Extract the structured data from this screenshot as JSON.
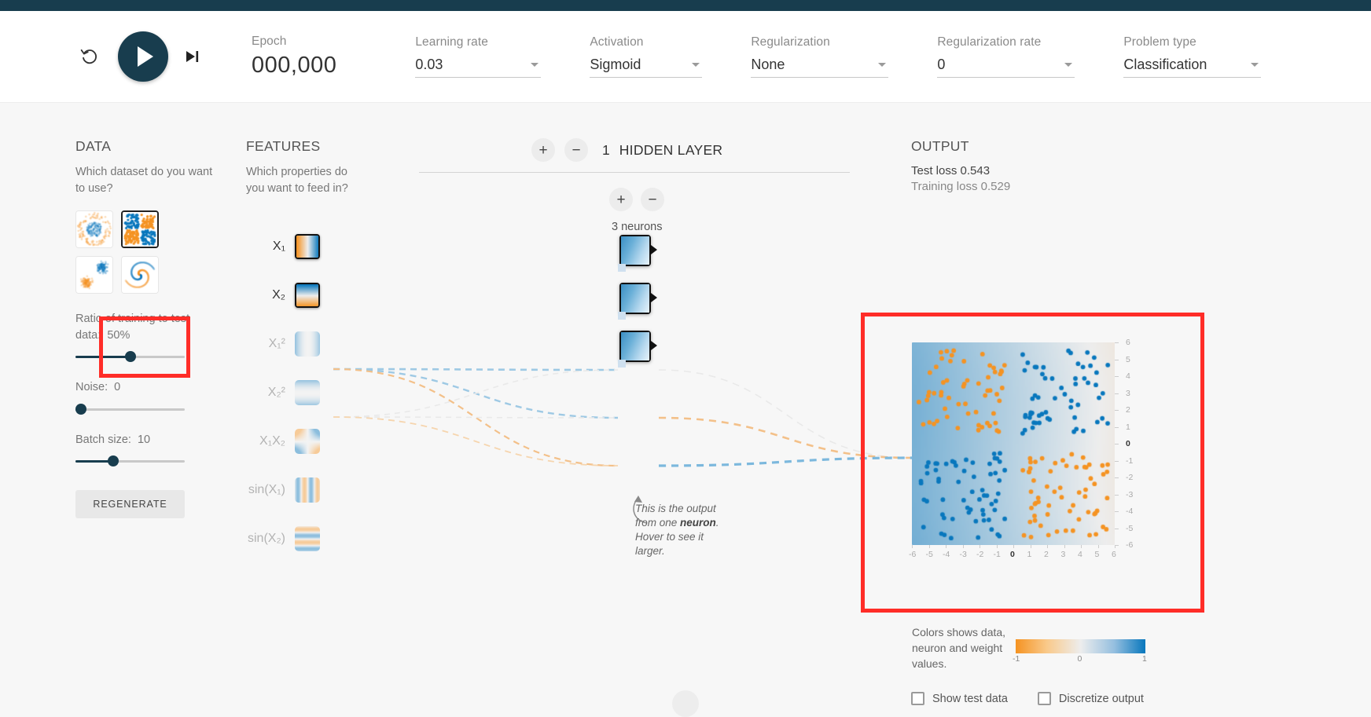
{
  "header": {
    "reset_icon": "reset-icon",
    "play_icon": "play-icon",
    "step_icon": "step-forward-icon",
    "epoch_label": "Epoch",
    "epoch_value": "000,000",
    "controls": [
      {
        "label": "Learning rate",
        "value": "0.03"
      },
      {
        "label": "Activation",
        "value": "Sigmoid"
      },
      {
        "label": "Regularization",
        "value": "None"
      },
      {
        "label": "Regularization rate",
        "value": "0"
      },
      {
        "label": "Problem type",
        "value": "Classification"
      }
    ]
  },
  "data_panel": {
    "title": "DATA",
    "subtitle": "Which dataset do you want to use?",
    "datasets": [
      {
        "name": "circle",
        "selected": false
      },
      {
        "name": "xor",
        "selected": true
      },
      {
        "name": "gauss",
        "selected": false
      },
      {
        "name": "spiral",
        "selected": false
      }
    ],
    "ratio_label": "Ratio of training to test data:",
    "ratio_value": "50%",
    "ratio_percent": 50,
    "noise_label": "Noise:",
    "noise_value": "0",
    "noise_percent": 0,
    "batch_label": "Batch size:",
    "batch_value": "10",
    "batch_percent": 33,
    "regenerate_label": "REGENERATE"
  },
  "features_panel": {
    "title": "FEATURES",
    "subtitle": "Which properties do you want to feed in?",
    "items": [
      {
        "label": "X₁",
        "active": true,
        "kind": "x1"
      },
      {
        "label": "X₂",
        "active": true,
        "kind": "x2"
      },
      {
        "label": "X₁²",
        "active": false,
        "kind": "x1sq"
      },
      {
        "label": "X₂²",
        "active": false,
        "kind": "x2sq"
      },
      {
        "label": "X₁X₂",
        "active": false,
        "kind": "x1x2"
      },
      {
        "label": "sin(X₁)",
        "active": false,
        "kind": "sinx1"
      },
      {
        "label": "sin(X₂)",
        "active": false,
        "kind": "sinx2"
      }
    ]
  },
  "network_panel": {
    "add_layer_icon": "plus-icon",
    "remove_layer_icon": "minus-icon",
    "layer_count": "1",
    "layer_text": "HIDDEN LAYER",
    "add_neuron_icon": "plus-icon",
    "remove_neuron_icon": "minus-icon",
    "neuron_count_label": "3 neurons",
    "neurons": [
      1,
      2,
      3
    ],
    "tooltip_pre": "This is the output from one ",
    "tooltip_bold": "neuron",
    "tooltip_post": ". Hover to see it larger."
  },
  "output_panel": {
    "title": "OUTPUT",
    "test_loss": "Test loss 0.543",
    "training_loss": "Training loss 0.529",
    "x_ticks": [
      "-6",
      "-5",
      "-4",
      "-3",
      "-2",
      "-1",
      "0",
      "1",
      "2",
      "3",
      "4",
      "5",
      "6"
    ],
    "y_ticks": [
      "6",
      "5",
      "4",
      "3",
      "2",
      "1",
      "0",
      "-1",
      "-2",
      "-3",
      "-4",
      "-5",
      "-6"
    ],
    "legend_text": "Colors shows data, neuron and weight values.",
    "legend_ticks": [
      "-1",
      "0",
      "1"
    ],
    "show_test_data_label": "Show test data",
    "discretize_label": "Discretize output"
  },
  "annotations": {
    "highlight_color": "#ff2d28",
    "boxes": [
      "dataset-thumbnail-highlight",
      "output-heatmap-highlight"
    ]
  },
  "colors": {
    "negative": "#f59322",
    "positive": "#0877bd",
    "accent_dark": "#183d4e"
  }
}
